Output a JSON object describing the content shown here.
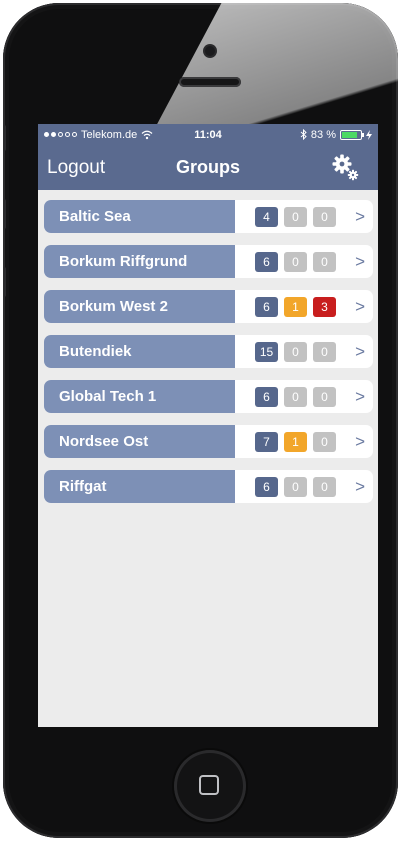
{
  "colors": {
    "header_bg": "#5a6a8f",
    "row_label_bg": "#7d90b6",
    "badge_blue": "#56678c",
    "badge_grey": "#c2c2c2",
    "badge_orange": "#f2a62a",
    "badge_red": "#c81e1e"
  },
  "statusbar": {
    "carrier": "Telekom.de",
    "time": "11:04",
    "battery": "83 %",
    "battery_level": 0.83
  },
  "navbar": {
    "left_label": "Logout",
    "title": "Groups",
    "settings_icon": "gear-icon"
  },
  "groups": [
    {
      "name": "Baltic Sea",
      "counts": [
        "4",
        "0",
        "0"
      ],
      "colors": [
        "blue",
        "grey",
        "grey"
      ]
    },
    {
      "name": "Borkum Riffgrund",
      "counts": [
        "6",
        "0",
        "0"
      ],
      "colors": [
        "blue",
        "grey",
        "grey"
      ]
    },
    {
      "name": "Borkum West 2",
      "counts": [
        "6",
        "1",
        "3"
      ],
      "colors": [
        "blue",
        "orange",
        "red"
      ]
    },
    {
      "name": "Butendiek",
      "counts": [
        "15",
        "0",
        "0"
      ],
      "colors": [
        "blue",
        "grey",
        "grey"
      ]
    },
    {
      "name": "Global Tech 1",
      "counts": [
        "6",
        "0",
        "0"
      ],
      "colors": [
        "blue",
        "grey",
        "grey"
      ]
    },
    {
      "name": "Nordsee Ost",
      "counts": [
        "7",
        "1",
        "0"
      ],
      "colors": [
        "blue",
        "orange",
        "grey"
      ]
    },
    {
      "name": "Riffgat",
      "counts": [
        "6",
        "0",
        "0"
      ],
      "colors": [
        "blue",
        "grey",
        "grey"
      ]
    }
  ],
  "row_chevron": ">"
}
